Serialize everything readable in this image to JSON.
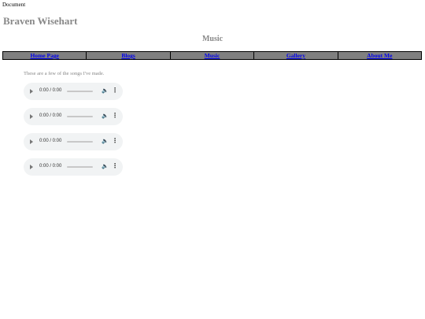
{
  "document_title": "Document",
  "site_title": "Braven Wisehart",
  "page_heading": "Music",
  "nav": {
    "items": [
      {
        "label": "Home Page"
      },
      {
        "label": "Blogs"
      },
      {
        "label": "Music"
      },
      {
        "label": "Gallery"
      },
      {
        "label": "About Me"
      }
    ]
  },
  "intro": "These are a few of the songs I've made.",
  "players": [
    {
      "time": "0:00 / 0:00"
    },
    {
      "time": "0:00 / 0:00"
    },
    {
      "time": "0:00 / 0:00"
    },
    {
      "time": "0:00 / 0:00"
    }
  ],
  "icons": {
    "play": "play-icon",
    "volume": "volume-icon",
    "more": "more-options-icon"
  }
}
